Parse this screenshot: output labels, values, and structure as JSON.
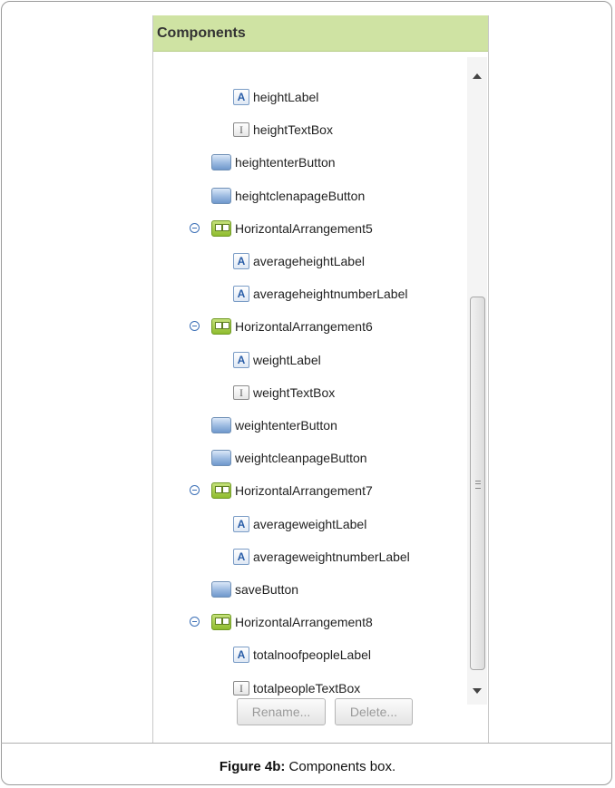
{
  "panel": {
    "title": "Components"
  },
  "tree": {
    "items": [
      {
        "label": "heightLabel",
        "icon": "label-icon",
        "level": 2
      },
      {
        "label": "heightTextBox",
        "icon": "textbox-icon",
        "level": 2
      },
      {
        "label": "heightenterButton",
        "icon": "button-icon",
        "level": 1
      },
      {
        "label": "heightclenapageButton",
        "icon": "button-icon",
        "level": 1
      },
      {
        "label": "HorizontalArrangement5",
        "icon": "horizontal-arrangement-icon",
        "level": 1,
        "collapsible": true
      },
      {
        "label": "averageheightLabel",
        "icon": "label-icon",
        "level": 2
      },
      {
        "label": "averageheightnumberLabel",
        "icon": "label-icon",
        "level": 2
      },
      {
        "label": "HorizontalArrangement6",
        "icon": "horizontal-arrangement-icon",
        "level": 1,
        "collapsible": true
      },
      {
        "label": "weightLabel",
        "icon": "label-icon",
        "level": 2
      },
      {
        "label": "weightTextBox",
        "icon": "textbox-icon",
        "level": 2
      },
      {
        "label": "weightenterButton",
        "icon": "button-icon",
        "level": 1
      },
      {
        "label": "weightcleanpageButton",
        "icon": "button-icon",
        "level": 1
      },
      {
        "label": "HorizontalArrangement7",
        "icon": "horizontal-arrangement-icon",
        "level": 1,
        "collapsible": true
      },
      {
        "label": "averageweightLabel",
        "icon": "label-icon",
        "level": 2
      },
      {
        "label": "averageweightnumberLabel",
        "icon": "label-icon",
        "level": 2
      },
      {
        "label": "saveButton",
        "icon": "button-icon",
        "level": 1
      },
      {
        "label": "HorizontalArrangement8",
        "icon": "horizontal-arrangement-icon",
        "level": 1,
        "collapsible": true
      },
      {
        "label": "totalnoofpeopleLabel",
        "icon": "label-icon",
        "level": 2
      },
      {
        "label": "totalpeopleTextBox",
        "icon": "textbox-icon",
        "level": 2
      }
    ]
  },
  "icons": {
    "label_glyph": "A",
    "textbox_glyph": "I"
  },
  "buttons": {
    "rename": "Rename...",
    "delete": "Delete..."
  },
  "caption": {
    "prefix": "Figure 4b:",
    "text": " Components box."
  },
  "colors": {
    "header_bg": "#cfe3a3",
    "collapse": "#3b6fb6"
  }
}
